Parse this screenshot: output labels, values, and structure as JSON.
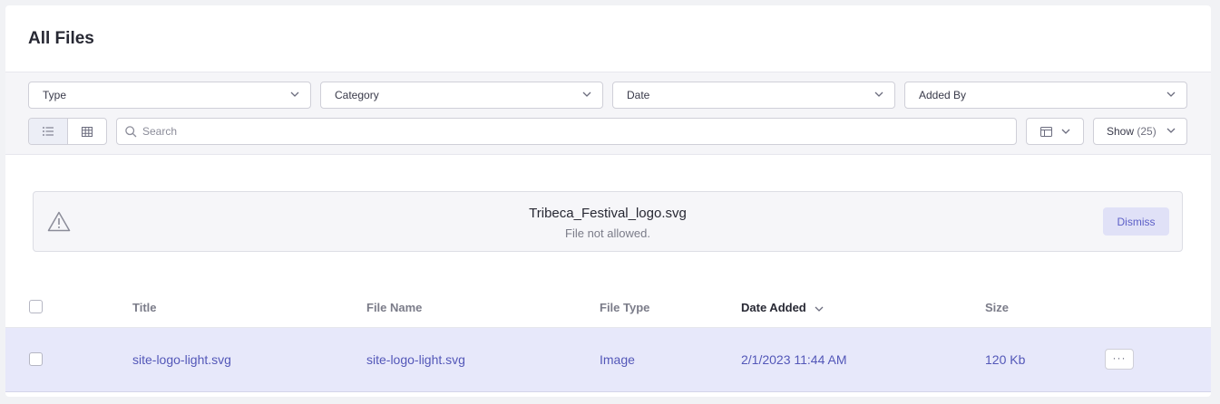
{
  "page": {
    "title": "All Files"
  },
  "filters": {
    "type": "Type",
    "category": "Category",
    "date": "Date",
    "added_by": "Added By"
  },
  "toolbar": {
    "search_placeholder": "Search",
    "show_label": "Show",
    "show_count": "(25)"
  },
  "alert": {
    "filename": "Tribeca_Festival_logo.svg",
    "message": "File not allowed.",
    "dismiss_label": "Dismiss"
  },
  "table": {
    "columns": {
      "title": "Title",
      "file_name": "File Name",
      "file_type": "File Type",
      "date_added": "Date Added",
      "size": "Size"
    },
    "rows": [
      {
        "title": "site-logo-light.svg",
        "file_name": "site-logo-light.svg",
        "file_type": "Image",
        "date_added": "2/1/2023 11:44 AM",
        "size": "120 Kb",
        "more_label": "···"
      }
    ]
  },
  "colors": {
    "accent": "#5357b8",
    "selected_row_bg": "#e7e8fa",
    "dismiss_bg": "#e0e1f7"
  }
}
